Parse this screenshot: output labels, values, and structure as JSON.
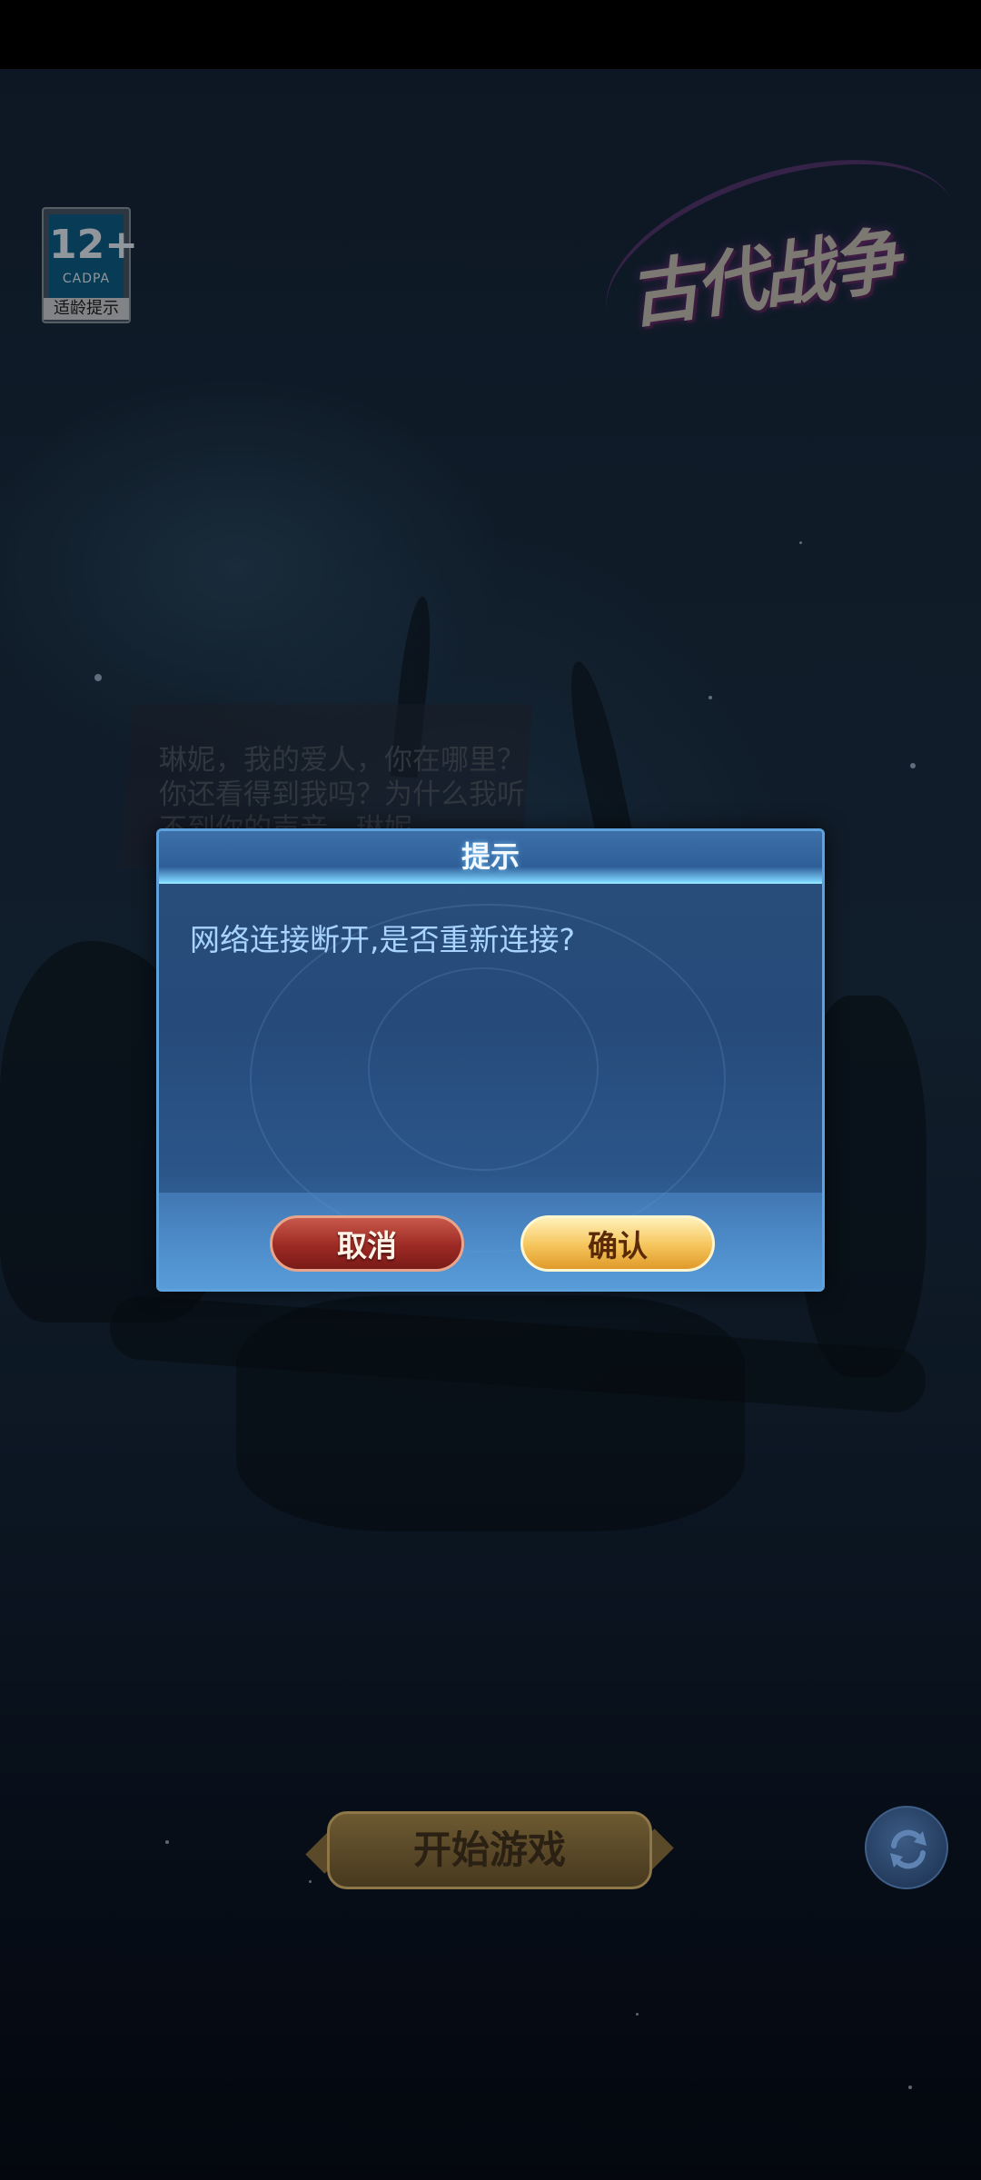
{
  "age_badge": {
    "rating": "12+",
    "org": "CADPA",
    "tip": "适龄提示"
  },
  "logo": {
    "title": "古代战争"
  },
  "story": {
    "text": "琳妮，我的爱人，你在哪里？你还看得到我吗？为什么我听不到你的声音，琳妮"
  },
  "dialog": {
    "title": "提示",
    "message": "网络连接断开,是否重新连接?",
    "cancel_label": "取消",
    "confirm_label": "确认"
  },
  "main": {
    "start_label": "开始游戏",
    "refresh_icon": "refresh-icon"
  },
  "colors": {
    "dialog_bg": "#264a79",
    "dialog_border": "#5da2dd",
    "message_text": "#a9d4ff",
    "cancel_button": "#9c2a24",
    "confirm_button": "#f5c45a",
    "start_button": "#574626"
  }
}
